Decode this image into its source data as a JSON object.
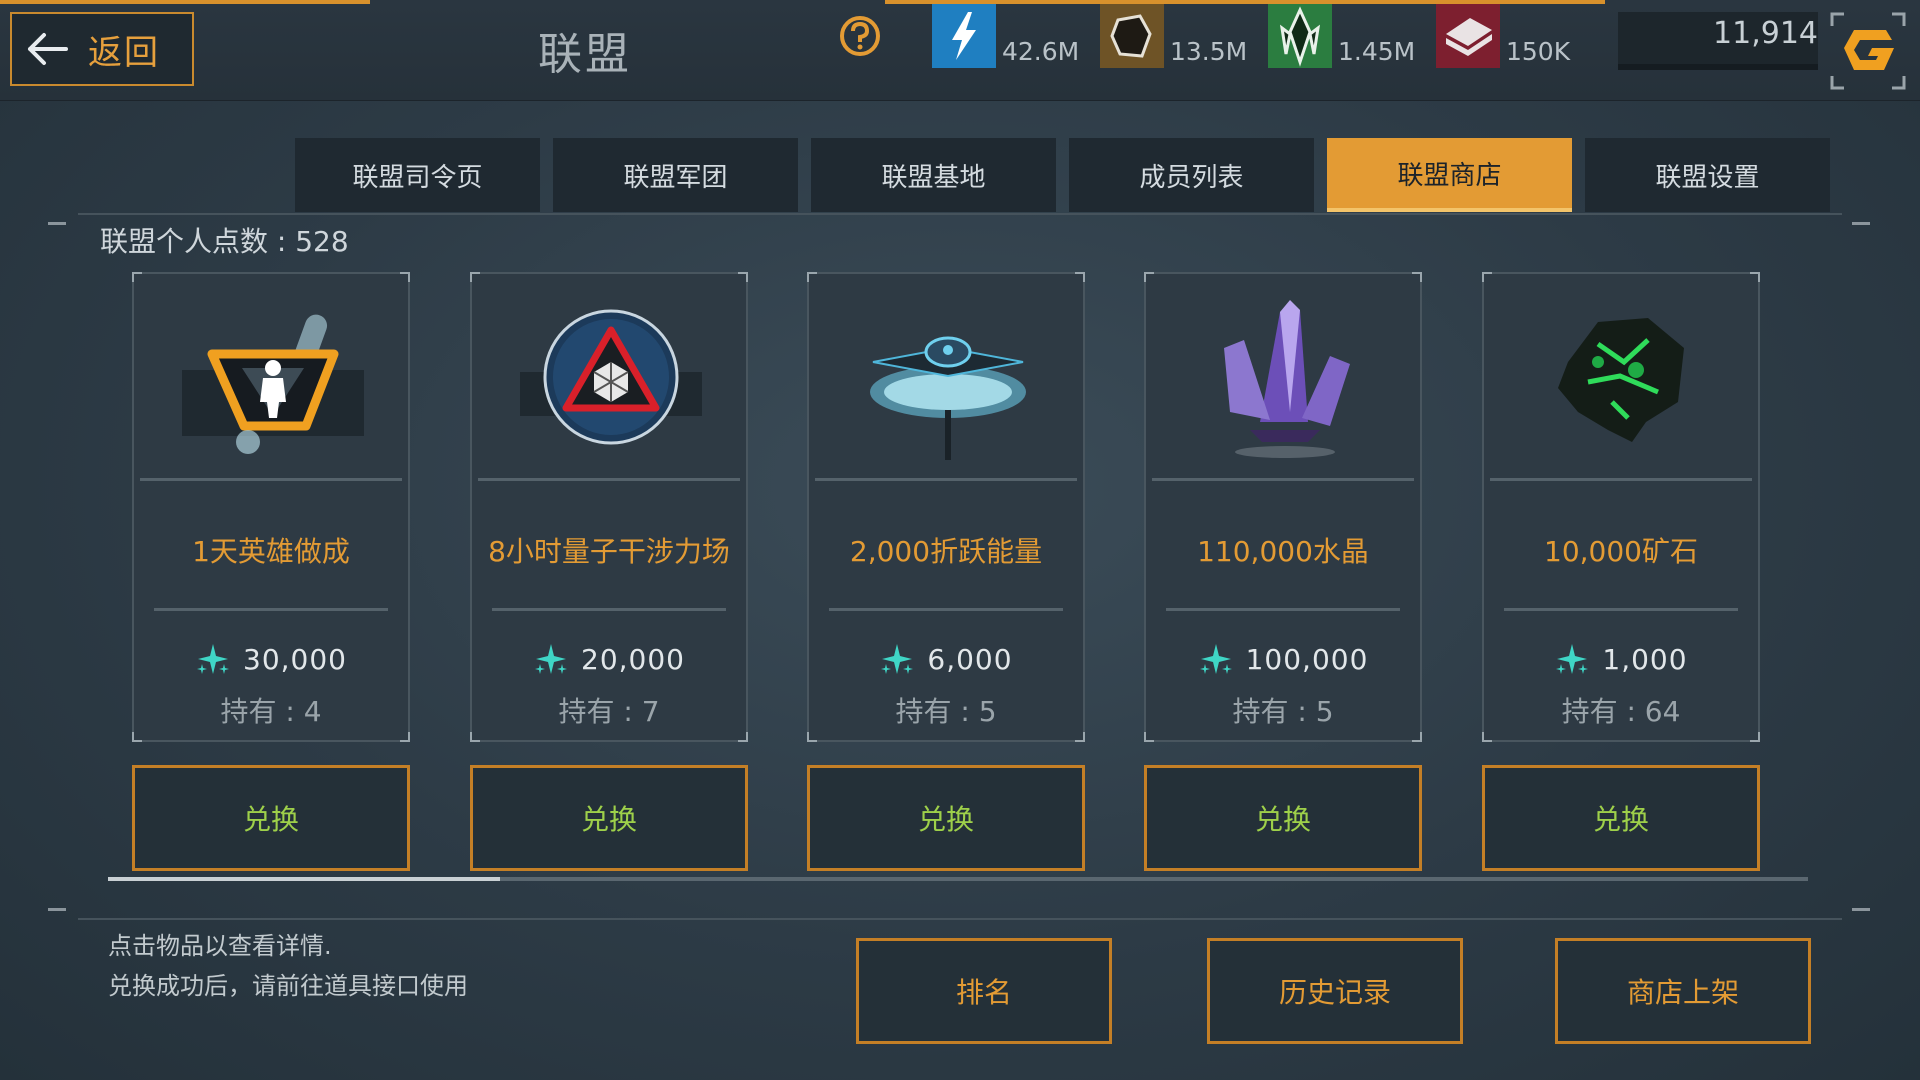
{
  "header": {
    "back_label": "返回",
    "title": "联盟",
    "resources": [
      {
        "icon": "energy-icon",
        "value": "42.6M",
        "color": "#1f7fc1"
      },
      {
        "icon": "ore-icon",
        "value": "13.5M",
        "color": "#7a5a2a"
      },
      {
        "icon": "crystal-icon",
        "value": "1.45M",
        "color": "#2e8a45"
      },
      {
        "icon": "alloy-icon",
        "value": "150K",
        "color": "#8b2333"
      }
    ],
    "currency_value": "11,914"
  },
  "tabs": [
    {
      "label": "联盟司令页",
      "active": false
    },
    {
      "label": "联盟军团",
      "active": false
    },
    {
      "label": "联盟基地",
      "active": false
    },
    {
      "label": "成员列表",
      "active": false
    },
    {
      "label": "联盟商店",
      "active": true
    },
    {
      "label": "联盟设置",
      "active": false
    }
  ],
  "points_label": "联盟个人点数 : 528",
  "items": [
    {
      "name": "1天英雄做成",
      "price": "30,000",
      "owned": "持有 : 4",
      "redeem": "兑换",
      "icon": "hero-boost-icon"
    },
    {
      "name": "8小时量子干涉力场",
      "price": "20,000",
      "owned": "持有 : 7",
      "redeem": "兑换",
      "icon": "quantum-shield-icon"
    },
    {
      "name": "2,000折跃能量",
      "price": "6,000",
      "owned": "持有 : 5",
      "redeem": "兑换",
      "icon": "warp-energy-icon"
    },
    {
      "name": "110,000水晶",
      "price": "100,000",
      "owned": "持有 : 5",
      "redeem": "兑换",
      "icon": "crystal-cluster-icon"
    },
    {
      "name": "10,000矿石",
      "price": "1,000",
      "owned": "持有 : 64",
      "redeem": "兑换",
      "icon": "green-ore-icon"
    }
  ],
  "hints": [
    "点击物品以查看详情.",
    "兑换成功后，请前往道具接口使用"
  ],
  "buttons": {
    "ranking": "排名",
    "history": "历史记录",
    "listing": "商店上架"
  },
  "colors": {
    "accent": "#e39b34",
    "redeem_text": "#9ed04a",
    "point_star": "#3fd6c6"
  }
}
